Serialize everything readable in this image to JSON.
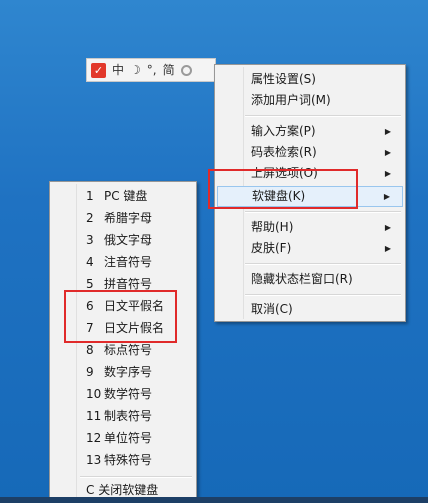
{
  "ime_bar": {
    "logo_symbol": "✓",
    "mode": "中",
    "punct_width": "☽",
    "punct": "°,",
    "charset": "简",
    "colors": {
      "logo": "#e2382b"
    }
  },
  "main_menu": {
    "items": [
      {
        "label": "属性设置(S)",
        "has_submenu": false
      },
      {
        "label": "添加用户词(M)",
        "has_submenu": false
      },
      {
        "label": "输入方案(P)",
        "has_submenu": true
      },
      {
        "label": "码表检索(R)",
        "has_submenu": true
      },
      {
        "label": "上屏选项(O)",
        "has_submenu": true
      },
      {
        "label": "软键盘(K)",
        "has_submenu": true,
        "highlighted": true
      },
      {
        "label": "帮助(H)",
        "has_submenu": true
      },
      {
        "label": "皮肤(F)",
        "has_submenu": true
      },
      {
        "label": "隐藏状态栏窗口(R)",
        "has_submenu": false
      },
      {
        "label": "取消(C)",
        "has_submenu": false
      }
    ],
    "arrow_glyph": "▶"
  },
  "soft_keyboard_menu": {
    "items": [
      {
        "num": "1",
        "label": "PC 键盘"
      },
      {
        "num": "2",
        "label": "希腊字母"
      },
      {
        "num": "3",
        "label": "俄文字母"
      },
      {
        "num": "4",
        "label": "注音符号"
      },
      {
        "num": "5",
        "label": "拼音符号"
      },
      {
        "num": "6",
        "label": "日文平假名"
      },
      {
        "num": "7",
        "label": "日文片假名"
      },
      {
        "num": "8",
        "label": "标点符号"
      },
      {
        "num": "9",
        "label": "数字序号"
      },
      {
        "num": "10",
        "label": "数学符号"
      },
      {
        "num": "11",
        "label": "制表符号"
      },
      {
        "num": "12",
        "label": "单位符号"
      },
      {
        "num": "13",
        "label": "特殊符号"
      }
    ],
    "close_item": {
      "num": "C",
      "label": "关闭软键盘"
    }
  },
  "annotation_color": "#e02a2a"
}
